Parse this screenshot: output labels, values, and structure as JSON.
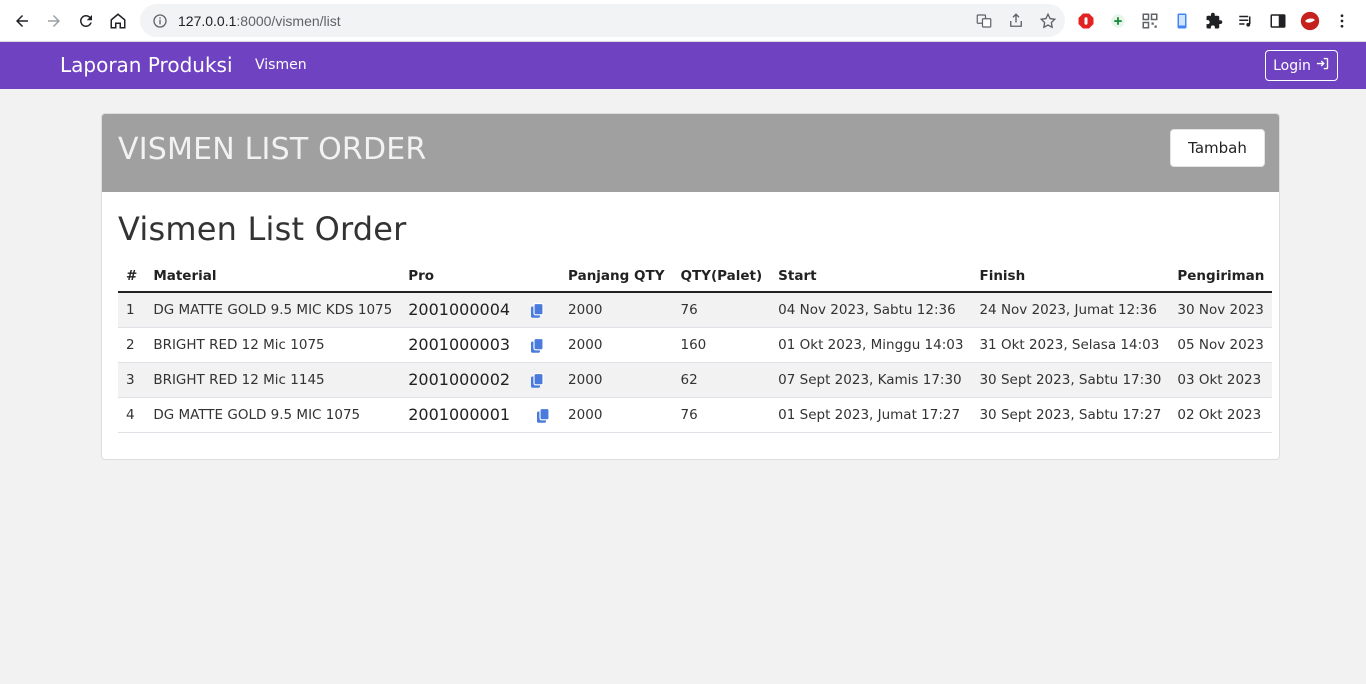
{
  "browser": {
    "url_host": "127.0.0.1",
    "url_path": ":8000/vismen/list"
  },
  "navbar": {
    "brand": "Laporan Produksi",
    "link_vismen": "Vismen",
    "login_label": "Login"
  },
  "card": {
    "header_title": "VISMEN LIST ORDER",
    "tambah_label": "Tambah",
    "body_title": "Vismen List Order"
  },
  "table": {
    "headers": [
      "#",
      "Material",
      "Pro",
      "Panjang QTY",
      "QTY(Palet)",
      "Start",
      "Finish",
      "Pengiriman"
    ],
    "rows": [
      {
        "no": "1",
        "material": "DG MATTE GOLD 9.5 MIC KDS 1075",
        "pro": "2001000004",
        "panjang": "2000",
        "qty": "76",
        "start": "04 Nov 2023, Sabtu 12:36",
        "finish": "24 Nov 2023, Jumat 12:36",
        "pengiriman": "30 Nov 2023"
      },
      {
        "no": "2",
        "material": "BRIGHT RED 12 Mic 1075",
        "pro": "2001000003",
        "panjang": "2000",
        "qty": "160",
        "start": "01 Okt 2023, Minggu 14:03",
        "finish": "31 Okt 2023, Selasa 14:03",
        "pengiriman": "05 Nov 2023"
      },
      {
        "no": "3",
        "material": "BRIGHT RED 12 Mic 1145",
        "pro": "2001000002",
        "panjang": "2000",
        "qty": "62",
        "start": "07 Sept 2023, Kamis 17:30",
        "finish": "30 Sept 2023, Sabtu 17:30",
        "pengiriman": "03 Okt 2023"
      },
      {
        "no": "4",
        "material": "DG MATTE GOLD 9.5 MIC 1075",
        "pro": "2001000001",
        "panjang": "2000",
        "qty": "76",
        "start": "01 Sept 2023, Jumat 17:27",
        "finish": "30 Sept 2023, Sabtu 17:27",
        "pengiriman": "02 Okt 2023"
      }
    ]
  },
  "colors": {
    "navbar": "#6f42c1",
    "card_header": "#a0a0a0",
    "copy_icon": "#4a7bdc"
  }
}
